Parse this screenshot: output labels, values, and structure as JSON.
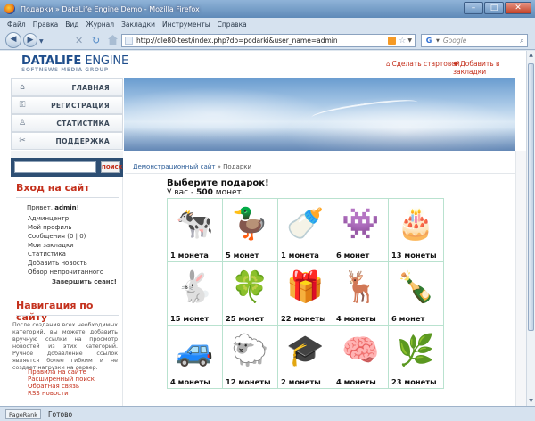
{
  "window": {
    "title": "Подарки » DataLife Engine Demo - Mozilla Firefox"
  },
  "menu": [
    "Файл",
    "Правка",
    "Вид",
    "Журнал",
    "Закладки",
    "Инструменты",
    "Справка"
  ],
  "toolbar": {
    "url": "http://dle80-test/index.php?do=podarki&user_name=admin",
    "search_placeholder": "Google"
  },
  "header": {
    "logo_main": "DATALIFE",
    "logo_second": "ENGINE",
    "logo_sub": "SOFTNEWS MEDIA GROUP",
    "link_home": "Сделать стартовой",
    "link_bookmark": "Добавить в закладки"
  },
  "nav": [
    {
      "label": "ГЛАВНАЯ",
      "icon": "home-icon"
    },
    {
      "label": "РЕГИСТРАЦИЯ",
      "icon": "key-icon"
    },
    {
      "label": "СТАТИСТИКА",
      "icon": "people-icon"
    },
    {
      "label": "ПОДДЕРЖКА",
      "icon": "tools-icon"
    }
  ],
  "search": {
    "button": "поиск"
  },
  "login": {
    "title": "Вход на сайт",
    "greeting": "Привет,",
    "username": "admin",
    "menu": [
      "Админцентр",
      "Мой профиль",
      "Сообщения (0 | 0)",
      "Мои закладки",
      "Статистика",
      "Добавить новость",
      "Обзор непрочитанного"
    ],
    "logout": "Завершить сеанс!"
  },
  "site_nav": {
    "title": "Навигация по сайту",
    "text": "После создания всех необходимых категорий, вы можете добавить вручную ссылки на просмотр новостей из этих категорий. Ручное добавление ссылок является более гибким и не создает нагрузки на сервер.",
    "links": [
      "Правила на сайте",
      "Расширенный поиск",
      "Обратная связь",
      "RSS новости"
    ]
  },
  "breadcrumb": {
    "site": "Демонстрационный сайт",
    "sep": "»",
    "current": "Подарки"
  },
  "gifts": {
    "title": "Выберите подарок!",
    "balance_prefix": "У вас -",
    "balance_value": "500",
    "balance_suffix": "монет.",
    "items": [
      {
        "icon": "cow-icon",
        "glyph": "🐄",
        "price": "1 монета"
      },
      {
        "icon": "duck-icon",
        "glyph": "🦆",
        "price": "5 монет"
      },
      {
        "icon": "pacifier-icon",
        "glyph": "🍼",
        "price": "1 монета"
      },
      {
        "icon": "monster-icon",
        "glyph": "👾",
        "price": "6 монет"
      },
      {
        "icon": "cake-icon",
        "glyph": "🎂",
        "price": "13 монеты"
      },
      {
        "icon": "rabbit-icon",
        "glyph": "🐇",
        "price": "15 монет"
      },
      {
        "icon": "leprechaun-icon",
        "glyph": "🍀",
        "price": "25 монет"
      },
      {
        "icon": "gift-box-icon",
        "glyph": "🎁",
        "price": "22 монеты"
      },
      {
        "icon": "fawn-icon",
        "glyph": "🦌",
        "price": "4 монеты"
      },
      {
        "icon": "champagne-icon",
        "glyph": "🍾",
        "price": "6 монет"
      },
      {
        "icon": "jeep-icon",
        "glyph": "🚙",
        "price": "4 монеты"
      },
      {
        "icon": "sheep-icon",
        "glyph": "🐑",
        "price": "12 монеты"
      },
      {
        "icon": "graduation-cap-icon",
        "glyph": "🎓",
        "price": "2 монеты"
      },
      {
        "icon": "brain-icon",
        "glyph": "🧠",
        "price": "4 монеты"
      },
      {
        "icon": "plant-icon",
        "glyph": "🌿",
        "price": "23 монеты"
      }
    ]
  },
  "status": {
    "pagerank": "PageRank",
    "text": "Готово"
  }
}
